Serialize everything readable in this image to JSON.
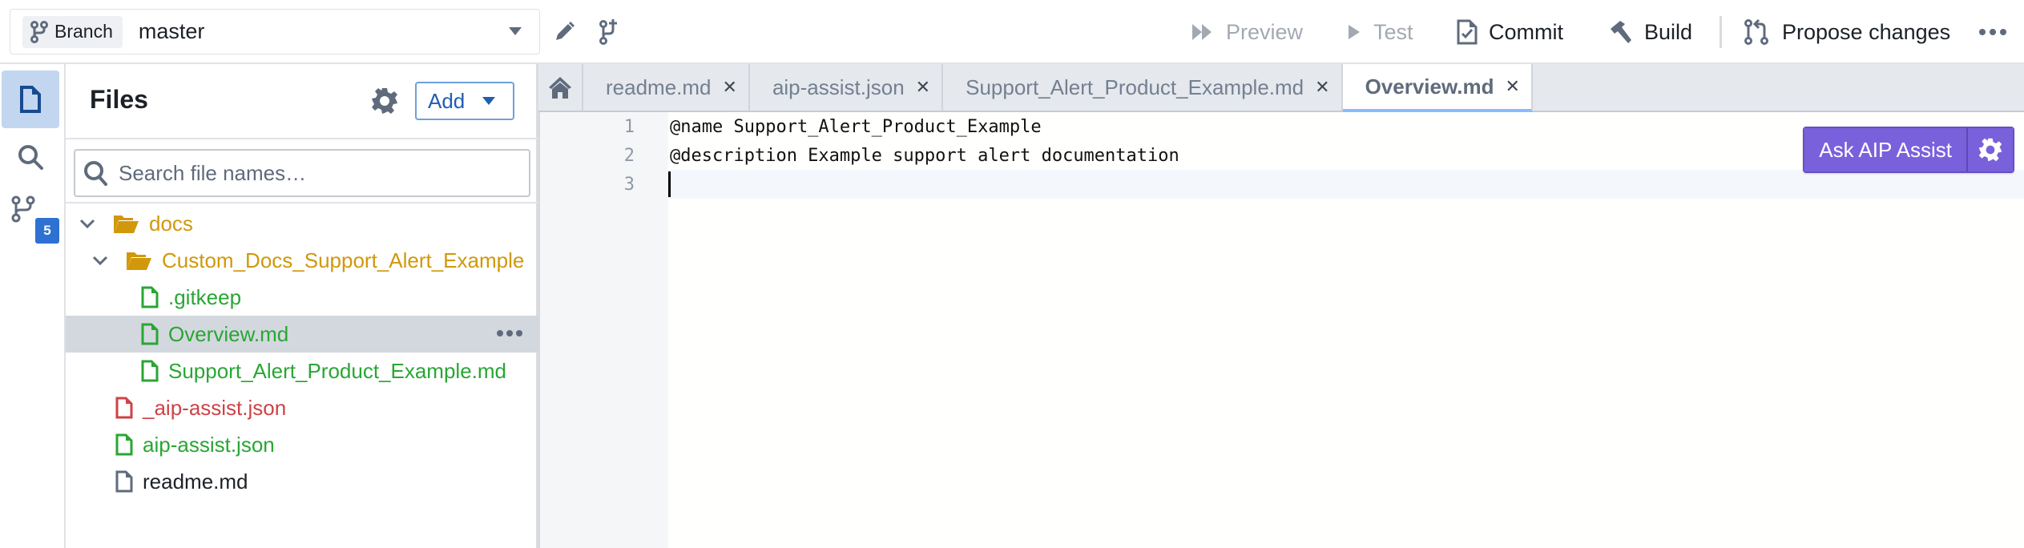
{
  "topbar": {
    "branch_tag_label": "Branch",
    "branch_value": "master",
    "actions": [
      {
        "label": "Preview",
        "icon": "fast-forward-icon",
        "disabled": true
      },
      {
        "label": "Test",
        "icon": "play-icon",
        "disabled": true
      },
      {
        "label": "Commit",
        "icon": "document-check-icon",
        "disabled": false
      },
      {
        "label": "Build",
        "icon": "hammer-icon",
        "disabled": false
      },
      {
        "label": "Propose changes",
        "icon": "git-pull-icon",
        "disabled": false
      }
    ],
    "more_icon": "more-icon"
  },
  "rail": {
    "items": [
      {
        "name": "files",
        "icon": "document-icon",
        "active": true
      },
      {
        "name": "search",
        "icon": "search-icon",
        "active": false
      },
      {
        "name": "changes",
        "icon": "git-branch-icon",
        "active": false,
        "badge": "5"
      }
    ]
  },
  "files": {
    "title": "Files",
    "add_label": "Add",
    "search_placeholder": "Search file names…",
    "tree": [
      {
        "label": "docs",
        "type": "folder",
        "status": "folder",
        "depth": 0,
        "expanded": true
      },
      {
        "label": "Custom_Docs_Support_Alert_Example",
        "type": "folder",
        "status": "folder",
        "depth": 1,
        "expanded": true
      },
      {
        "label": ".gitkeep",
        "type": "file",
        "status": "added",
        "depth": 2
      },
      {
        "label": "Overview.md",
        "type": "file",
        "status": "added",
        "depth": 2,
        "selected": true
      },
      {
        "label": "Support_Alert_Product_Example.md",
        "type": "file",
        "status": "added",
        "depth": 2
      },
      {
        "label": "_aip-assist.json",
        "type": "file",
        "status": "deleted",
        "depth": 1
      },
      {
        "label": "aip-assist.json",
        "type": "file",
        "status": "added",
        "depth": 1
      },
      {
        "label": "readme.md",
        "type": "file",
        "status": "plain",
        "depth": 1
      }
    ]
  },
  "editor": {
    "tabs": [
      {
        "label": "readme.md",
        "active": false
      },
      {
        "label": "aip-assist.json",
        "active": false
      },
      {
        "label": "Support_Alert_Product_Example.md",
        "active": false
      },
      {
        "label": "Overview.md",
        "active": true
      }
    ],
    "lines": [
      {
        "num": "1",
        "text": "@name Support_Alert_Product_Example"
      },
      {
        "num": "2",
        "text": "@description Example support alert documentation"
      },
      {
        "num": "3",
        "text": ""
      }
    ],
    "aip_button_label": "Ask AIP Assist"
  },
  "colors": {
    "accent": "#2d72d2",
    "aip": "#7961db",
    "folder": "#d1980b",
    "added": "#29a634",
    "deleted": "#cd4246"
  }
}
